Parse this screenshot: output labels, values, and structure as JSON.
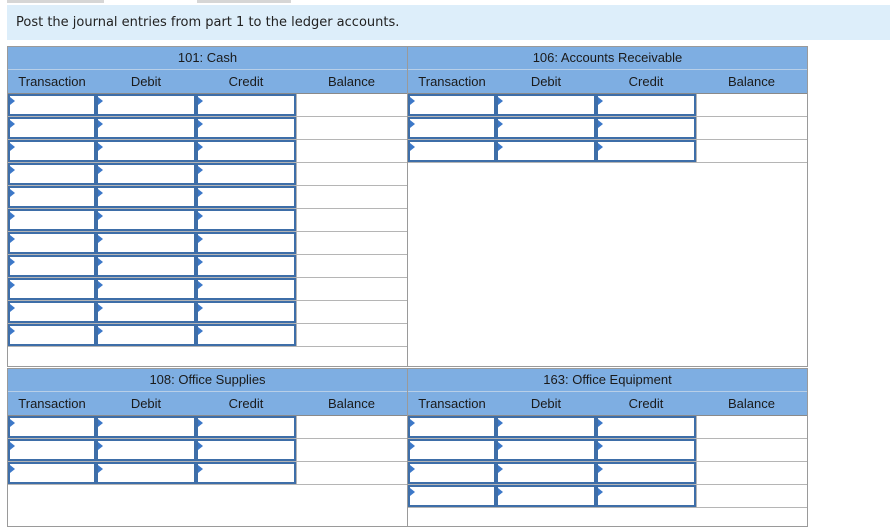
{
  "instruction": "Post the journal entries from part 1 to the ledger accounts.",
  "columns": {
    "transaction": "Transaction",
    "debit": "Debit",
    "credit": "Credit",
    "balance": "Balance"
  },
  "ledgers": [
    {
      "id": "cash",
      "title": "101: Cash",
      "rows": 11
    },
    {
      "id": "accounts-receivable",
      "title": "106: Accounts Receivable",
      "rows": 3
    },
    {
      "id": "office-supplies",
      "title": "108: Office Supplies",
      "rows": 3
    },
    {
      "id": "office-equipment",
      "title": "163: Office Equipment",
      "rows": 4
    }
  ]
}
